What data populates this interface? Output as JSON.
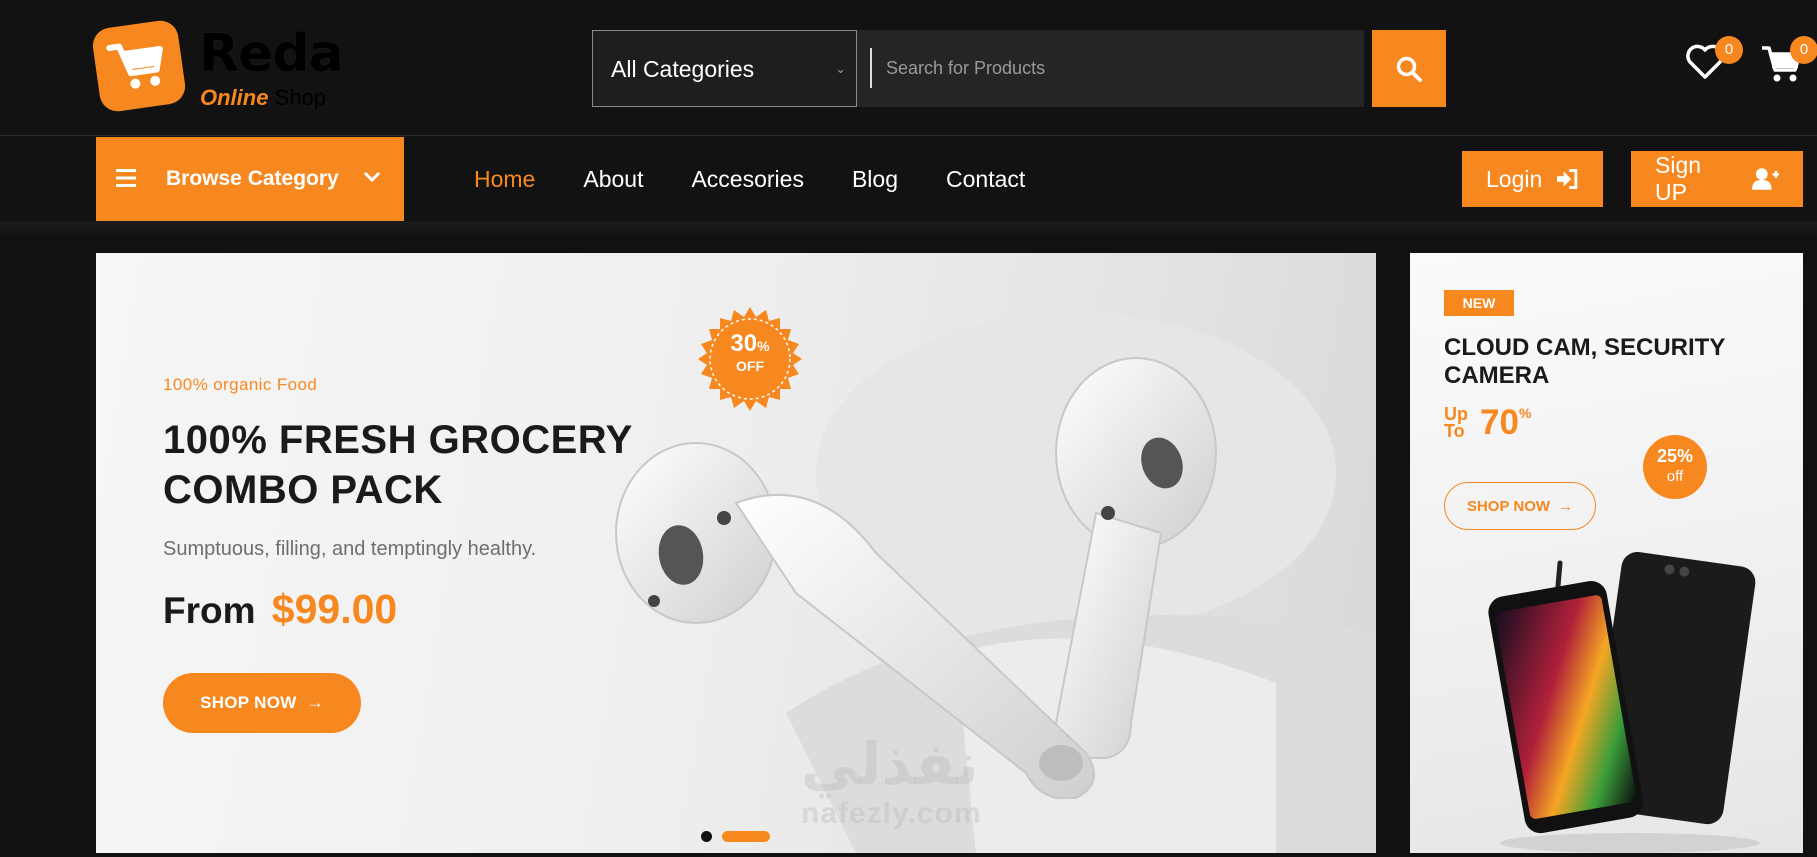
{
  "brand": {
    "name": "Reda",
    "tag_part1": "Online",
    "tag_part2": "Shop",
    "accent_color": "#f7881f",
    "background_color": "#121212"
  },
  "search": {
    "category_selected": "All Categories",
    "placeholder": "Search for Products",
    "button_icon": "search-icon"
  },
  "header_icons": {
    "wishlist_count": "0",
    "cart_count": "0"
  },
  "nav": {
    "browse_label": "Browse Category",
    "items": [
      {
        "label": "Home",
        "active": true
      },
      {
        "label": "About",
        "active": false
      },
      {
        "label": "Accesories",
        "active": false
      },
      {
        "label": "Blog",
        "active": false
      },
      {
        "label": "Contact",
        "active": false
      }
    ],
    "login_label": "Login",
    "signup_label": "Sign UP"
  },
  "hero": {
    "tagline": "100% organic Food",
    "title": "100% FRESH GROCERY COMBO PACK",
    "subtitle": "Sumptuous, filling, and temptingly healthy.",
    "price_prefix": "From",
    "price": "$99.00",
    "cta": "SHOP NOW",
    "badge_value": "30",
    "badge_unit": "%",
    "badge_off": "OFF",
    "slides_total": 2,
    "active_slide": 2
  },
  "promo": {
    "badge": "NEW",
    "title": "CLOUD CAM, SECURITY CAMERA",
    "upto_line1": "Up",
    "upto_line2": "To",
    "percent": "70",
    "percent_sign": "%",
    "discount_value": "25%",
    "discount_off": "off",
    "cta": "SHOP NOW"
  },
  "watermark": {
    "arabic": "نفذلي",
    "latin": "nafezly.com"
  }
}
